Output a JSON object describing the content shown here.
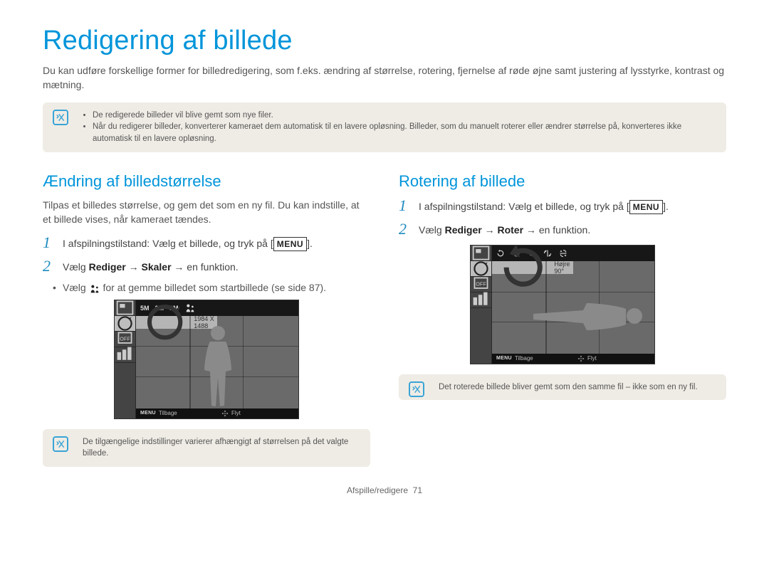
{
  "title": "Redigering af billede",
  "intro": "Du kan udføre forskellige former for billedredigering, som f.eks. ændring af størrelse, rotering, fjernelse af røde øjne samt justering af lysstyrke, kontrast og mætning.",
  "top_note": {
    "items": [
      "De redigerede billeder vil blive gemt som nye filer.",
      "Når du redigerer billeder, konverterer kameraet dem automatisk til en lavere opløsning. Billeder, som du manuelt roterer eller ændrer størrelse på, konverteres ikke automatisk til en lavere opløsning."
    ]
  },
  "left": {
    "heading": "Ændring af billedstørrelse",
    "para": "Tilpas et billedes størrelse, og gem det som en ny fil. Du kan indstille, at et billede vises, når kameraet tændes.",
    "step1_prefix": "I afspilningstilstand: Vælg et billede, og tryk på [",
    "step1_menu": "MENU",
    "step1_suffix": "].",
    "step2_prefix": "Vælg ",
    "step2_b1": "Rediger",
    "step2_arrow": " → ",
    "step2_b2": "Skaler",
    "step2_suffix": " → en funktion.",
    "sub_prefix": "Vælg ",
    "sub_suffix": " for at gemme billedet som startbillede (se side 87).",
    "screen": {
      "toolbar": [
        "5M",
        "3M",
        "1M"
      ],
      "hint": "1984 X 1488",
      "back": "Tilbage",
      "move": "Flyt",
      "menu": "MENU"
    },
    "note": "De tilgængelige indstillinger varierer afhængigt af størrelsen på det valgte billede."
  },
  "right": {
    "heading": "Rotering af billede",
    "step1_prefix": "I afspilningstilstand: Vælg et billede, og tryk på [",
    "step1_menu": "MENU",
    "step1_suffix": "].",
    "step2_prefix": "Vælg ",
    "step2_b1": "Rediger",
    "step2_arrow": " → ",
    "step2_b2": "Roter",
    "step2_suffix": " → en funktion.",
    "screen": {
      "hint": "Højre 90°",
      "back": "Tilbage",
      "move": "Flyt",
      "menu": "MENU"
    },
    "note": "Det roterede billede bliver gemt som den samme fil – ikke som en ny fil."
  },
  "footer": {
    "section": "Afspille/redigere",
    "page": "71"
  }
}
